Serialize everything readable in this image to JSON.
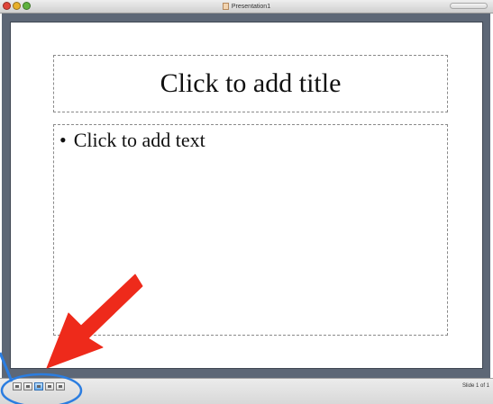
{
  "window": {
    "title": "Presentation1"
  },
  "slide": {
    "title_placeholder": "Click to add title",
    "body_bullet": "•",
    "body_placeholder": "Click to add text"
  },
  "statusbar": {
    "view_buttons": [
      {
        "icon": "normal-view-icon"
      },
      {
        "icon": "outline-view-icon"
      },
      {
        "icon": "slide-view-icon",
        "active": true
      },
      {
        "icon": "slide-sorter-view-icon"
      },
      {
        "icon": "slide-show-view-icon"
      }
    ],
    "slide_count": "Slide 1 of 1"
  },
  "colors": {
    "stage_background": "#5d6776",
    "annotation_circle": "#2b7de0",
    "annotation_arrow": "#ee2a1b"
  }
}
